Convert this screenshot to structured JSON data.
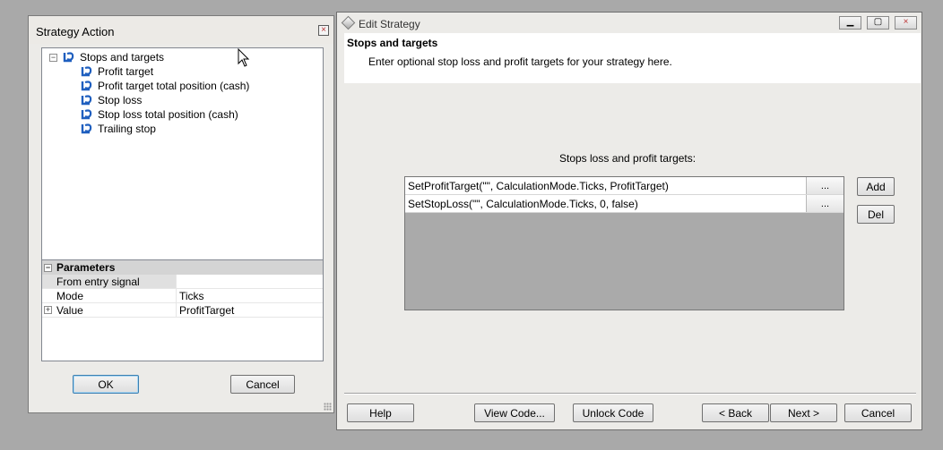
{
  "strategy_action": {
    "title": "Strategy Action",
    "tree": {
      "root": "Stops and targets",
      "children": [
        "Profit target",
        "Profit target total position (cash)",
        "Stop loss",
        "Stop loss total position (cash)",
        "Trailing stop"
      ]
    },
    "parameters": {
      "header": "Parameters",
      "rows": [
        {
          "name": "From entry signal",
          "value": ""
        },
        {
          "name": "Mode",
          "value": "Ticks"
        },
        {
          "name": "Value",
          "value": "ProfitTarget"
        }
      ]
    },
    "ok_label": "OK",
    "cancel_label": "Cancel"
  },
  "edit_strategy": {
    "title": "Edit Strategy",
    "header_title": "Stops and targets",
    "header_subtitle": "Enter optional stop loss and profit targets for your strategy here.",
    "list_label": "Stops loss and profit targets:",
    "rows": [
      {
        "text": "SetProfitTarget(\"\", CalculationMode.Ticks, ProfitTarget)",
        "button": "..."
      },
      {
        "text": "SetStopLoss(\"\", CalculationMode.Ticks, 0, false)",
        "button": "..."
      }
    ],
    "add_label": "Add",
    "del_label": "Del",
    "footer": {
      "help": "Help",
      "view_code": "View Code...",
      "unlock_code": "Unlock Code",
      "back": "< Back",
      "next": "Next >",
      "cancel": "Cancel"
    }
  },
  "colors": {
    "desktop": "#a9a9a9",
    "window": "#ecebe8",
    "icon_blue": "#1f5fbf"
  }
}
